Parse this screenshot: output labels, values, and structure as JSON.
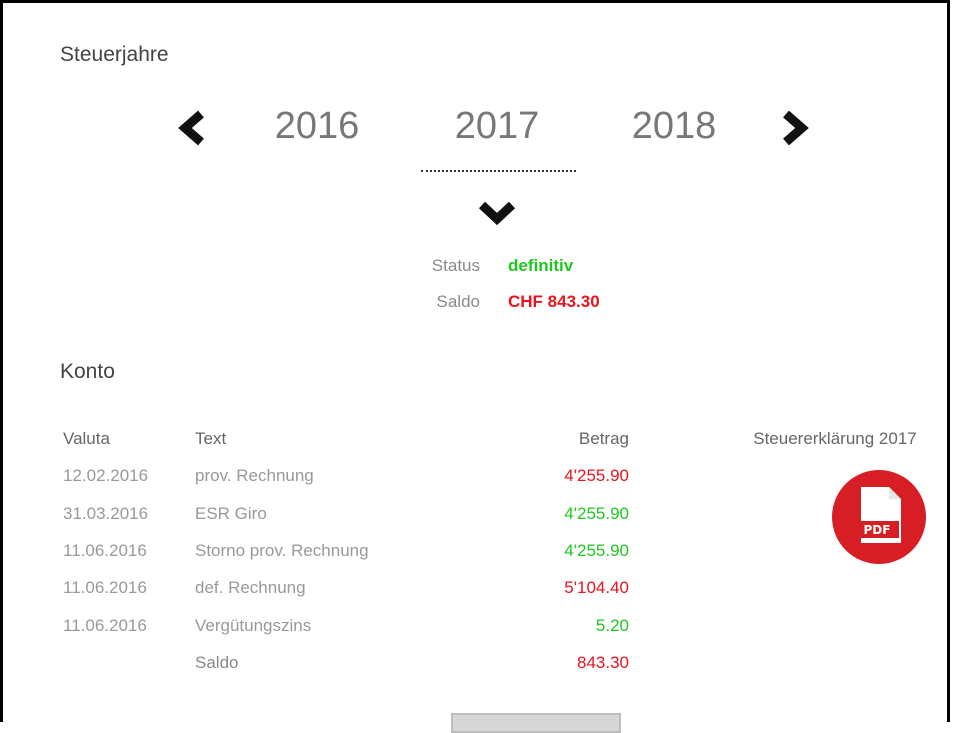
{
  "tax_years": {
    "title": "Steuerjahre",
    "years": [
      "2016",
      "2017",
      "2018"
    ],
    "selected": "2017"
  },
  "status": {
    "status_label": "Status",
    "status_value": "definitiv",
    "saldo_label": "Saldo",
    "saldo_value": "CHF 843.30"
  },
  "account": {
    "title": "Konto",
    "columns": {
      "valuta": "Valuta",
      "text": "Text",
      "betrag": "Betrag"
    },
    "rows": [
      {
        "date": "12.02.2016",
        "text": "prov. Rechnung",
        "amount": "4'255.90",
        "sign": "debit"
      },
      {
        "date": "31.03.2016",
        "text": "ESR Giro",
        "amount": "4'255.90",
        "sign": "credit"
      },
      {
        "date": "11.06.2016",
        "text": "Storno prov. Rechnung",
        "amount": "4'255.90",
        "sign": "credit"
      },
      {
        "date": "11.06.2016",
        "text": "def. Rechnung",
        "amount": "5'104.40",
        "sign": "debit"
      },
      {
        "date": "11.06.2016",
        "text": "Vergütungszins",
        "amount": "5.20",
        "sign": "credit"
      }
    ],
    "saldo_label": "Saldo",
    "saldo_amount": "843.30"
  },
  "tax_return": {
    "title": "Steuererklärung 2017",
    "pdf_label": "PDF"
  },
  "colors": {
    "credit": "#1ec81e",
    "debit": "#e8141e",
    "pdf_red": "#d81e25"
  },
  "icons": {
    "prev": "chevron-left-icon",
    "next": "chevron-right-icon",
    "expand": "chevron-down-icon",
    "pdf": "pdf-file-icon"
  }
}
